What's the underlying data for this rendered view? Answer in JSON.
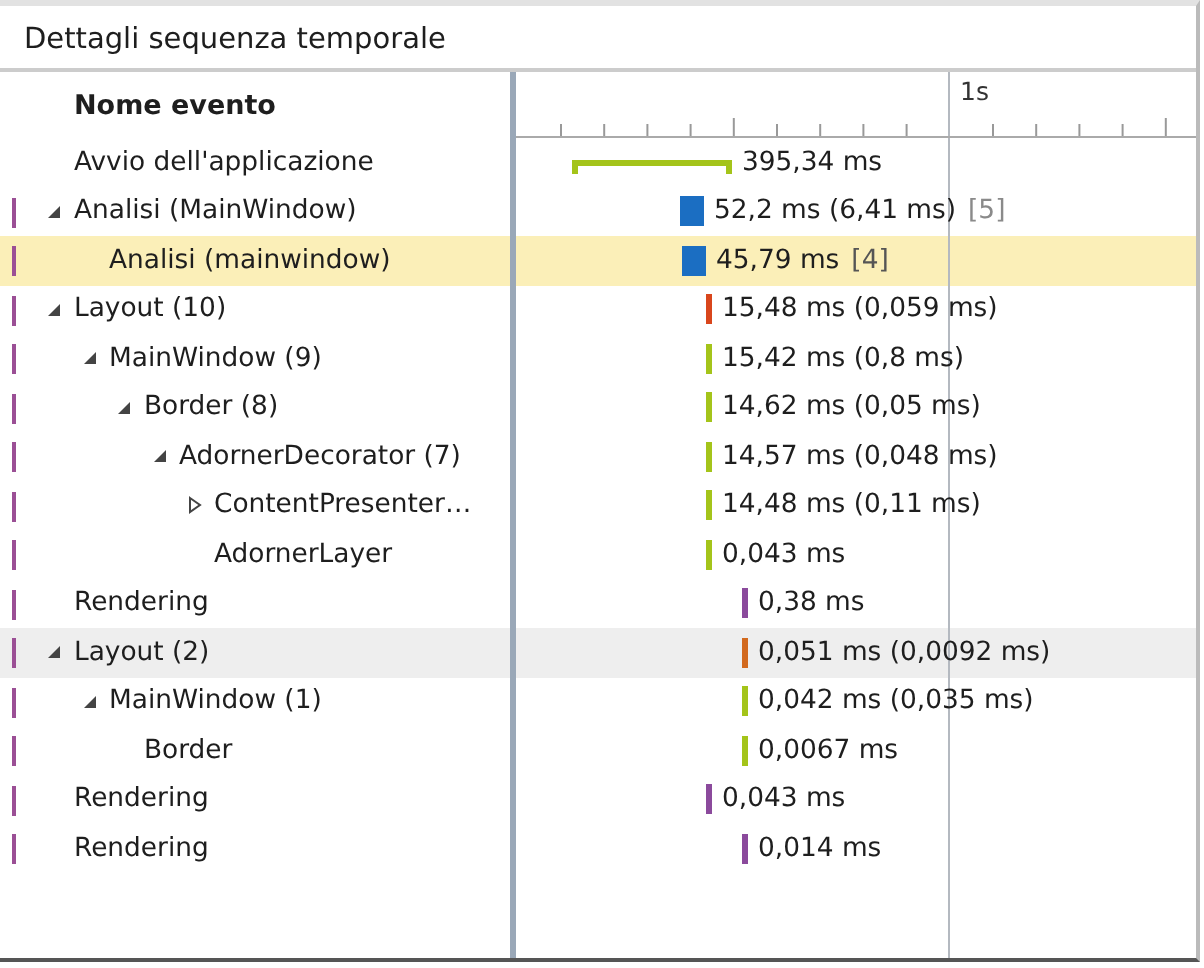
{
  "panel": {
    "title": "Dettagli sequenza temporale"
  },
  "columns": {
    "name_header": "Nome evento",
    "ruler_label": "1s"
  },
  "events": [
    {
      "name": "Avvio dell'applicazione",
      "marked": false,
      "selected": false,
      "shaded": false,
      "duration": "395,34 ms",
      "bar": {
        "kind": "span",
        "color": "#a4c41a"
      }
    },
    {
      "name": "Analisi (MainWindow)",
      "expanded": true,
      "marked": true,
      "selected": false,
      "shaded": false,
      "duration": "52,2 ms (6,41 ms)",
      "count": "[5]",
      "bar": {
        "kind": "block",
        "color": "#1b6ec2"
      },
      "children": [
        {
          "name": "Analisi (mainwindow)",
          "marked": true,
          "selected": true,
          "shaded": false,
          "duration": "45,79 ms",
          "count": "[4]",
          "bar": {
            "kind": "block",
            "color": "#1b6ec2"
          }
        }
      ]
    },
    {
      "name": "Layout (10)",
      "expanded": true,
      "marked": true,
      "selected": false,
      "shaded": false,
      "duration": "15,48 ms (0,059 ms)",
      "bar": {
        "kind": "tick",
        "color": "#d9461c"
      },
      "children": [
        {
          "name": "MainWindow (9)",
          "expanded": true,
          "marked": true,
          "selected": false,
          "shaded": false,
          "duration": "15,42 ms (0,8 ms)",
          "bar": {
            "kind": "tick",
            "color": "#a4c41a"
          },
          "children": [
            {
              "name": "Border (8)",
              "expanded": true,
              "marked": true,
              "selected": false,
              "shaded": false,
              "duration": "14,62 ms (0,05 ms)",
              "bar": {
                "kind": "tick",
                "color": "#a4c41a"
              },
              "children": [
                {
                  "name": "AdornerDecorator (7)",
                  "expanded": true,
                  "marked": true,
                  "selected": false,
                  "shaded": false,
                  "duration": "14,57 ms (0,048 ms)",
                  "bar": {
                    "kind": "tick",
                    "color": "#a4c41a"
                  },
                  "children": [
                    {
                      "name": "ContentPresenter…",
                      "expanded": false,
                      "marked": true,
                      "selected": false,
                      "shaded": false,
                      "duration": "14,48 ms (0,11 ms)",
                      "bar": {
                        "kind": "tick",
                        "color": "#a4c41a"
                      }
                    },
                    {
                      "name": "AdornerLayer",
                      "marked": true,
                      "selected": false,
                      "shaded": false,
                      "duration": "0,043 ms",
                      "bar": {
                        "kind": "tick",
                        "color": "#a4c41a"
                      }
                    }
                  ]
                }
              ]
            }
          ]
        }
      ]
    },
    {
      "name": "Rendering",
      "marked": true,
      "selected": false,
      "shaded": false,
      "duration": "0,38 ms",
      "bar": {
        "kind": "tick",
        "color": "#8b4a9c"
      }
    },
    {
      "name": "Layout (2)",
      "expanded": true,
      "marked": true,
      "selected": false,
      "shaded": true,
      "duration": "0,051 ms (0,0092 ms)",
      "bar": {
        "kind": "tick",
        "color": "#d2691e"
      },
      "children": [
        {
          "name": "MainWindow (1)",
          "expanded": true,
          "marked": true,
          "selected": false,
          "shaded": false,
          "duration": "0,042 ms (0,035 ms)",
          "bar": {
            "kind": "tick",
            "color": "#a4c41a"
          },
          "children": [
            {
              "name": "Border",
              "marked": true,
              "selected": false,
              "shaded": false,
              "duration": "0,0067 ms",
              "bar": {
                "kind": "tick",
                "color": "#a4c41a"
              }
            }
          ]
        }
      ]
    },
    {
      "name": "Rendering",
      "marked": true,
      "selected": false,
      "shaded": false,
      "duration": "0,043 ms",
      "bar": {
        "kind": "tick",
        "color": "#8b4a9c"
      }
    },
    {
      "name": "Rendering",
      "marked": true,
      "selected": false,
      "shaded": false,
      "duration": "0,014 ms",
      "bar": {
        "kind": "tick",
        "color": "#8b4a9c"
      }
    }
  ]
}
